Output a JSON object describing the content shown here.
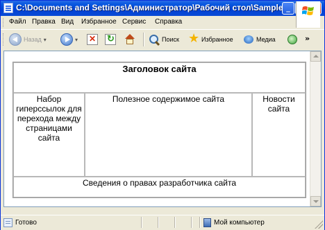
{
  "window": {
    "title": "C:\\Documents and Settings\\Администратор\\Рабочий стол\\Samples\\Macromed..."
  },
  "menu": [
    "Файл",
    "Правка",
    "Вид",
    "Избранное",
    "Сервис",
    "Справка"
  ],
  "toolbar": {
    "back_label": "Назад",
    "search_label": "Поиск",
    "favorites_label": "Избранное",
    "media_label": "Медиа",
    "more_label": "»"
  },
  "page": {
    "header": "Заголовок сайта",
    "nav": "Набор гиперссылок для перехода между страницами сайта",
    "main": "Полезное содержимое сайта",
    "news": "Новости сайта",
    "footer": "Сведения о правах разработчика сайта"
  },
  "status": {
    "left": "Готово",
    "zone": "Мой компьютер"
  }
}
